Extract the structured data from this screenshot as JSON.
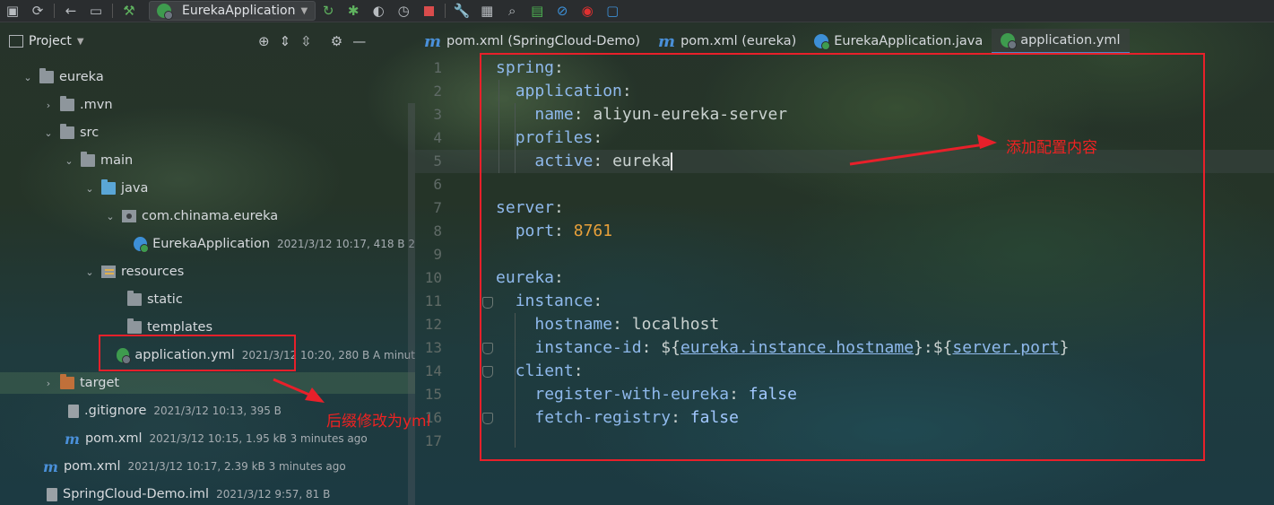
{
  "toolbar": {
    "run_config": "EurekaApplication",
    "icons": [
      "save-all-icon",
      "sync-icon",
      "back-icon",
      "terminal-frame-icon",
      "build-hammer-icon",
      "run-icon",
      "debug-icon",
      "coverage-icon",
      "profile-icon",
      "stop-icon",
      "settings-wrench-icon",
      "project-structure-icon",
      "search-icon",
      "excel-icon",
      "no-entry-icon",
      "record-icon",
      "plugin-icon"
    ]
  },
  "project": {
    "title": "Project",
    "tree": [
      {
        "label": "eureka",
        "meta": ""
      },
      {
        "label": ".mvn",
        "meta": ""
      },
      {
        "label": "src",
        "meta": ""
      },
      {
        "label": "main",
        "meta": ""
      },
      {
        "label": "java",
        "meta": ""
      },
      {
        "label": "com.chinama.eureka",
        "meta": ""
      },
      {
        "label": "EurekaApplication",
        "meta": "2021/3/12 10:17, 418 B 2"
      },
      {
        "label": "resources",
        "meta": ""
      },
      {
        "label": "static",
        "meta": ""
      },
      {
        "label": "templates",
        "meta": ""
      },
      {
        "label": "application.yml",
        "meta": "2021/3/12 10:20, 280 B A minut"
      },
      {
        "label": "target",
        "meta": ""
      },
      {
        "label": ".gitignore",
        "meta": "2021/3/12 10:13, 395 B"
      },
      {
        "label": "pom.xml",
        "meta": "2021/3/12 10:15, 1.95 kB 3 minutes ago"
      },
      {
        "label": "pom.xml",
        "meta": "2021/3/12 10:17, 2.39 kB 3 minutes ago"
      },
      {
        "label": "SpringCloud-Demo.iml",
        "meta": "2021/3/12 9:57, 81 B"
      }
    ]
  },
  "tabs": [
    {
      "label": "pom.xml (SpringCloud-Demo)"
    },
    {
      "label": "pom.xml (eureka)"
    },
    {
      "label": "EurekaApplication.java"
    },
    {
      "label": "application.yml"
    }
  ],
  "editor": {
    "line_numbers": [
      "1",
      "2",
      "3",
      "4",
      "5",
      "6",
      "7",
      "8",
      "9",
      "10",
      "11",
      "12",
      "13",
      "14",
      "15",
      "16",
      "17"
    ],
    "lines": {
      "l1_key": "spring",
      "l2_key": "application",
      "l3_key": "name",
      "l3_val": "aliyun-eureka-server",
      "l4_key": "profiles",
      "l5_key": "active",
      "l5_val": "eureka",
      "l7_key": "server",
      "l8_key": "port",
      "l8_val": "8761",
      "l10_key": "eureka",
      "l11_key": "instance",
      "l12_key": "hostname",
      "l12_val": "localhost",
      "l13_key": "instance-id",
      "l13_p1": "${",
      "l13_ref1": "eureka.instance.hostname",
      "l13_p2": "}:${",
      "l13_ref2": "server.port",
      "l13_p3": "}",
      "l14_key": "client",
      "l15_key": "register-with-eureka",
      "l15_val": "false",
      "l16_key": "fetch-registry",
      "l16_val": "false",
      "colon": ":"
    }
  },
  "annotations": {
    "editor_note": "添加配置内容",
    "file_note": "后缀修改为yml"
  },
  "colors": {
    "annotation_red": "#e8202a",
    "yaml_key": "#8fb9ec",
    "number": "#e8a03a"
  }
}
